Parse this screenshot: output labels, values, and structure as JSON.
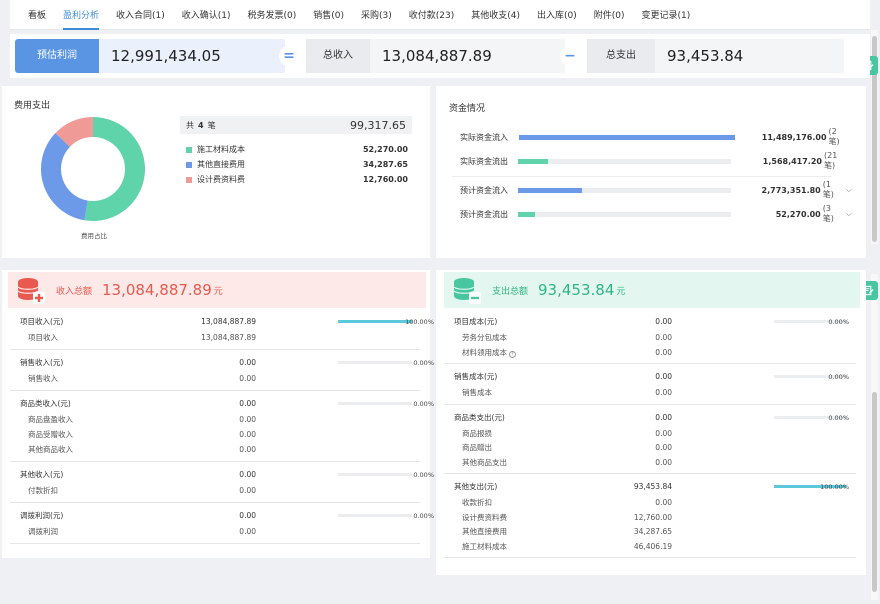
{
  "tabs": [
    "看板",
    "盈利分析",
    "收入合同(1)",
    "收入确认(1)",
    "税务发票(0)",
    "销售(0)",
    "采购(3)",
    "收付款(23)",
    "其他收支(4)",
    "出入库(0)",
    "附件(0)",
    "变更记录(1)"
  ],
  "summary": {
    "profit_label": "预估利润",
    "profit_value": "12,991,434.05",
    "eq_sign": "=",
    "income_label": "总收入",
    "income_value": "13,084,887.89",
    "minus_sign": "−",
    "expense_label": "总支出",
    "expense_value": "93,453.84"
  },
  "cost_panel": {
    "title": "费用支出",
    "total_prefix": "共",
    "total_count": "4",
    "total_suffix": "笔",
    "total_amount": "99,317.65",
    "chart_caption": "费用占比",
    "items": [
      {
        "name": "施工材料成本",
        "value": "52,270.00",
        "color": "#5fd3aa"
      },
      {
        "name": "其他直接费用",
        "value": "34,287.65",
        "color": "#6c9ae8"
      },
      {
        "name": "设计费资料费",
        "value": "12,760.00",
        "color": "#f09a98"
      }
    ]
  },
  "cash_panel": {
    "title": "资金情况",
    "rows": [
      {
        "name": "实际资金流入",
        "amount": "11,489,176.00",
        "count": "(2笔)",
        "fill": 1.0,
        "color": "#6c9ae8",
        "chev": ""
      },
      {
        "name": "实际资金流出",
        "amount": "1,568,417.20",
        "count": "(21笔)",
        "fill": 0.14,
        "color": "#5fd3aa",
        "chev": ""
      },
      {
        "name": "预计资金流入",
        "amount": "2,773,351.80",
        "count": "(1笔)",
        "fill": 0.3,
        "color": "#6c9ae8",
        "chev": "⌵"
      },
      {
        "name": "预计资金流出",
        "amount": "52,270.00",
        "count": "(3笔)",
        "fill": 0.08,
        "color": "#5fd3aa",
        "chev": "⌵"
      }
    ]
  },
  "income_panel": {
    "label": "收入总额",
    "value": "13,084,887.89",
    "unit": "元",
    "groups": [
      {
        "name": "项目收入(元)",
        "value": "13,084,887.89",
        "pct": "100.00%",
        "fill": 1.0,
        "subs": [
          {
            "name": "项目收入",
            "value": "13,084,887.89"
          }
        ]
      },
      {
        "name": "销售收入(元)",
        "value": "0.00",
        "pct": "0.00%",
        "fill": 0,
        "subs": [
          {
            "name": "销售收入",
            "value": "0.00"
          }
        ]
      },
      {
        "name": "商品类收入(元)",
        "value": "0.00",
        "pct": "0.00%",
        "fill": 0,
        "subs": [
          {
            "name": "商品盘盈收入",
            "value": "0.00"
          },
          {
            "name": "商品受赠收入",
            "value": "0.00"
          },
          {
            "name": "其他商品收入",
            "value": "0.00"
          }
        ]
      },
      {
        "name": "其他收入(元)",
        "value": "0.00",
        "pct": "0.00%",
        "fill": 0,
        "subs": [
          {
            "name": "付款折扣",
            "value": "0.00"
          }
        ]
      },
      {
        "name": "调拨利润(元)",
        "value": "0.00",
        "pct": "0.00%",
        "fill": 0,
        "subs": [
          {
            "name": "调拨利润",
            "value": "0.00"
          }
        ]
      }
    ]
  },
  "expense_panel": {
    "label": "支出总额",
    "value": "93,453.84",
    "unit": "元",
    "groups": [
      {
        "name": "项目成本(元)",
        "value": "0.00",
        "pct": "0.00%",
        "fill": 0,
        "subs": [
          {
            "name": "劳务分包成本",
            "value": "0.00"
          },
          {
            "name": "材料领用成本",
            "value": "0.00",
            "help": "?"
          }
        ]
      },
      {
        "name": "销售成本(元)",
        "value": "0.00",
        "pct": "0.00%",
        "fill": 0,
        "subs": [
          {
            "name": "销售成本",
            "value": "0.00"
          }
        ]
      },
      {
        "name": "商品类支出(元)",
        "value": "0.00",
        "pct": "0.00%",
        "fill": 0,
        "subs": [
          {
            "name": "商品报损",
            "value": "0.00"
          },
          {
            "name": "商品赠出",
            "value": "0.00"
          },
          {
            "name": "其他商品支出",
            "value": "0.00"
          }
        ]
      },
      {
        "name": "其他支出(元)",
        "value": "93,453.84",
        "pct": "100.00%",
        "fill": 1.0,
        "subs": [
          {
            "name": "收款折扣",
            "value": "0.00"
          },
          {
            "name": "设计费资料费",
            "value": "12,760.00"
          },
          {
            "name": "其他直接费用",
            "value": "34,287.65"
          },
          {
            "name": "施工材料成本",
            "value": "46,406.19"
          }
        ]
      }
    ]
  },
  "colors": {
    "accent": "#3c8cd8",
    "income_head_bg": "#fde9e7",
    "income_value": "#e85a4f",
    "expense_head_bg": "#e3f6ef",
    "expense_value": "#2fb583"
  }
}
